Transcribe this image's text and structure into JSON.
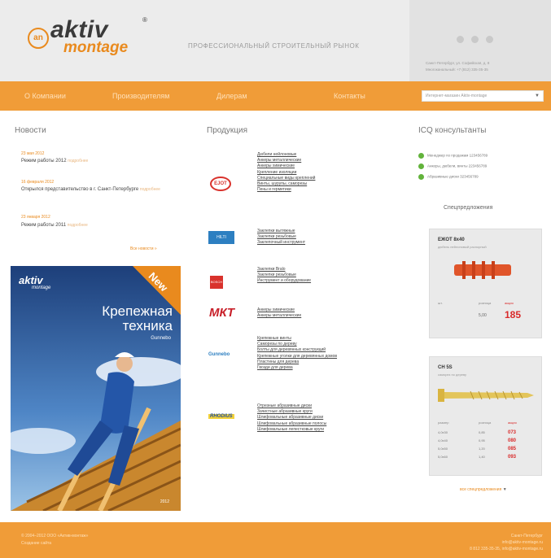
{
  "header": {
    "logo_mark": "an",
    "logo_top": "aktiv",
    "logo_bottom": "montage",
    "logo_reg": "®",
    "tagline": "ПРОФЕССИОНАЛЬНЫЙ СТРОИТЕЛЬНЫЙ РЫНОК",
    "contact_line1": "Санкт-Петербург, ул. Софийская, д. 8",
    "contact_line2": "Многоканальный: +7 (812) 335-35-35"
  },
  "nav": {
    "items": [
      "О Компании",
      "Производителям",
      "Дилерам",
      "Контакты"
    ],
    "select_value": "Интернет-магазин Aktiv-montage"
  },
  "news": {
    "heading": "Новости",
    "items": [
      {
        "date": "23 мая 2012",
        "title": "Режим работы 2012",
        "more": "подробнее"
      },
      {
        "date": "16 февраля 2012",
        "title": "Открылся представительство в г. Санкт-Петербурге",
        "more": "подробнее"
      },
      {
        "date": "23 января 2012",
        "title": "Режим работы 2011",
        "more": "подробнее"
      }
    ],
    "all_label": "Все новости »"
  },
  "poster": {
    "logo_top": "aktiv",
    "logo_bottom": "montage",
    "badge": "New",
    "title_line1": "Крепежная",
    "title_line2": "техника",
    "brand": "Gunnebo",
    "footer": "2012"
  },
  "products": {
    "heading": "Продукция",
    "groups": [
      {
        "logo": "EJOT",
        "links": [
          "Дюбели нейлоновые",
          "Анкеры металлические",
          "Анкеры химические",
          "Крепление изоляции",
          "Специальные виды креплений",
          "Винты, шурупы, саморезы",
          "Пены и герметики"
        ]
      },
      {
        "logo": "HILTI",
        "links": [
          "Заклепки вытяжные",
          "Заклепки резьбовые",
          "Заклепочный инструмент"
        ]
      },
      {
        "logo": "BOSCH",
        "links": [
          "Заклепки Bralo",
          "Заклепки резьбовые",
          "Инструмент и оборудование"
        ]
      },
      {
        "logo": "МКТ",
        "links": [
          "Анкеры химические",
          "Анкеры металлические"
        ]
      },
      {
        "logo": "Gunnebo",
        "links": [
          "Крепежные винты",
          "Саморезы по дереву",
          "Болты для деревянных конструкций",
          "Крепежные уголки для деревянных домов",
          "Пластины для дерева",
          "Гвозди для дерева"
        ]
      },
      {
        "logo": "RHODIUS",
        "links": [
          "Отрезные абразивные диски",
          "Зачистные абразивные круги",
          "Шлифовальные абразивные диски",
          "Шлифовальные абразивные полосы",
          "Шлифовальные лепестковые круги"
        ]
      }
    ]
  },
  "icq": {
    "heading": "ICQ консультанты",
    "rows": [
      {
        "name": "Менеджер по продажам",
        "number": "123456789"
      },
      {
        "name": "Анкеры, дюбели, винты",
        "number": "223456789"
      },
      {
        "name": "Абразивные диски",
        "number": "323456789"
      }
    ]
  },
  "special": {
    "heading": "Спецпредложения",
    "cards": [
      {
        "title": "ЕЖОТ 8х40",
        "sub": "дюбель нейлоновый распорный",
        "col1": "шт.",
        "col2": "розница",
        "col3": "акция",
        "old_price": "5,00",
        "price": "185"
      },
      {
        "title": "СН 5S",
        "sub": "саморез по дереву",
        "col1": "размер",
        "col2": "розница",
        "col3": "акция",
        "rows": [
          {
            "size": "4,0х30",
            "retail": "0,85",
            "sale": "073"
          },
          {
            "size": "4,0х40",
            "retail": "0,95",
            "sale": "080"
          },
          {
            "size": "5,0х50",
            "retail": "1,20",
            "sale": "085"
          },
          {
            "size": "5,0х60",
            "retail": "1,40",
            "sale": "093"
          }
        ]
      }
    ],
    "all_label": "все спецпредложения"
  },
  "footer": {
    "left_line1": "© 2004–2012 ООО «Актив-монтаж»",
    "left_line2": "Создание сайта",
    "right_line1": "Санкт-Петербург",
    "right_line2": "info@aktiv-montage.ru",
    "right_line3": "8 812 335-35-35, info@aktiv-montage.ru"
  },
  "colors": {
    "accent": "#f09c38",
    "header_bg": "#ececec",
    "icq_online": "#62b33b",
    "price": "#d92a2a"
  }
}
